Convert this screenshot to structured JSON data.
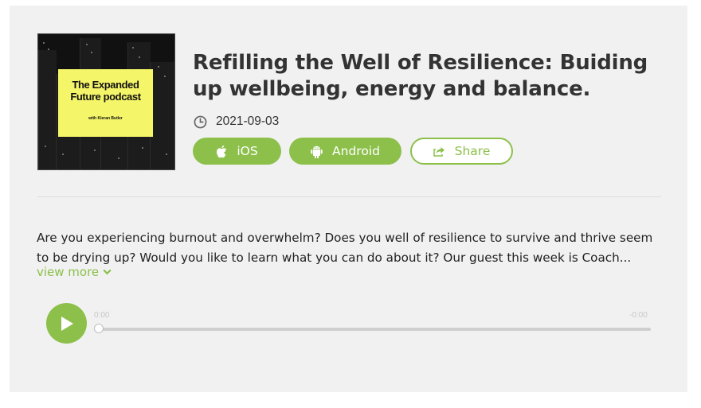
{
  "episode": {
    "title": "Refilling the Well of Resilience: Buiding up wellbeing, energy and balance.",
    "date": "2021-09-03",
    "cover": {
      "title": "The Expanded Future podcast",
      "subtitle": "with Kieran Butler"
    }
  },
  "buttons": {
    "ios": "iOS",
    "android": "Android",
    "share": "Share"
  },
  "description": {
    "text": "Are you experiencing burnout and overwhelm? Does you well of resilience to survive and thrive seem to be drying up? Would you like to learn what you can do about it? Our guest this week is Coach...",
    "view_more": "view more"
  },
  "player": {
    "current_time": "0:00",
    "remaining_time": "-0:00",
    "progress": 0
  },
  "colors": {
    "accent": "#8cc04b",
    "card_background": "#f1f1f1"
  },
  "icons": [
    "clock-icon",
    "apple-icon",
    "android-icon",
    "share-icon",
    "chevron-down-icon",
    "play-icon"
  ]
}
